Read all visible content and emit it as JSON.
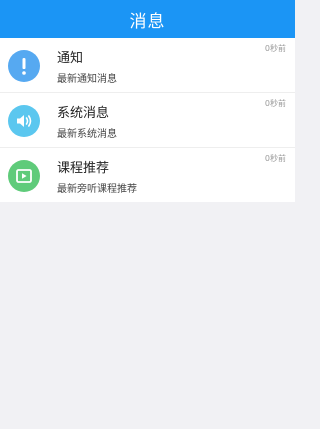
{
  "header": {
    "title": "消息"
  },
  "colors": {
    "accent": "#1b95f5",
    "notice_icon_bg": "#56a9f1",
    "system_icon_bg": "#5bc7ef",
    "course_icon_bg": "#5fcb7a"
  },
  "messages": [
    {
      "icon": "exclamation-icon",
      "title": "通知",
      "desc": "最新通知消息",
      "time": "0秒前"
    },
    {
      "icon": "speaker-icon",
      "title": "系统消息",
      "desc": "最新系统消息",
      "time": "0秒前"
    },
    {
      "icon": "video-play-icon",
      "title": "课程推荐",
      "desc": "最新旁听课程推荐",
      "time": "0秒前"
    }
  ]
}
